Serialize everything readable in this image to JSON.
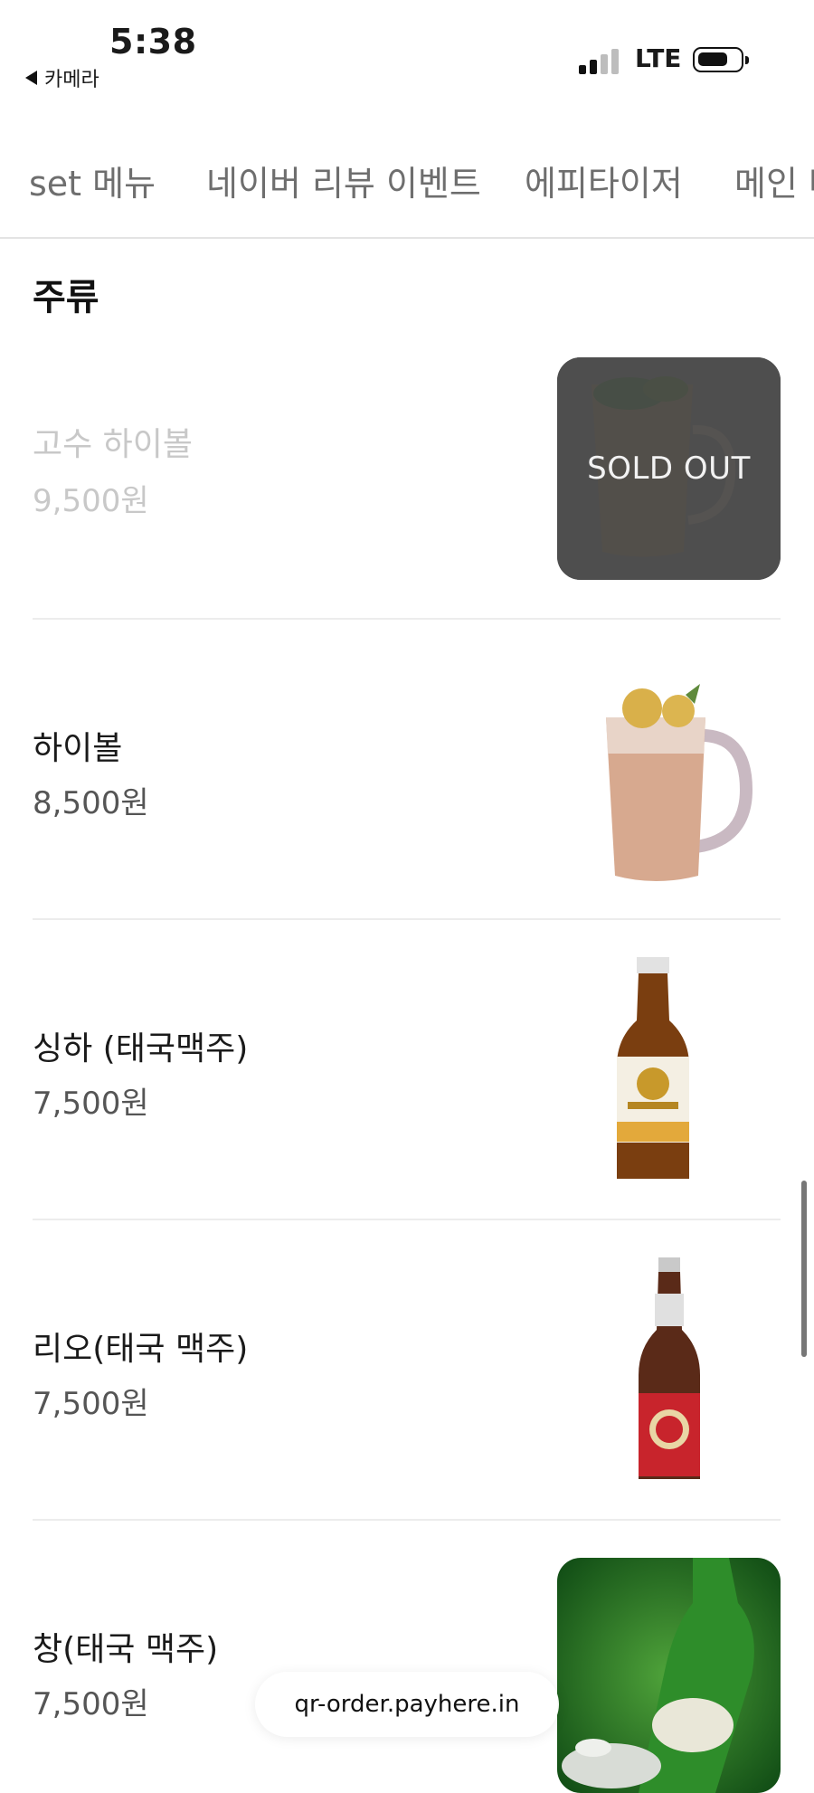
{
  "status_bar": {
    "time": "5:38",
    "back_app": "카메라",
    "network": "LTE"
  },
  "tabs": [
    "set 메뉴",
    "네이버 리뷰 이벤트",
    "에피타이저",
    "메인 다"
  ],
  "section": {
    "title": "주류"
  },
  "items": [
    {
      "name": "고수 하이볼",
      "price": "9,500원",
      "sold_out": true,
      "badge": "SOLD OUT"
    },
    {
      "name": "하이볼",
      "price": "8,500원",
      "sold_out": false
    },
    {
      "name": "싱하 (태국맥주)",
      "price": "7,500원",
      "sold_out": false
    },
    {
      "name": "리오(태국 맥주)",
      "price": "7,500원",
      "sold_out": false
    },
    {
      "name": "창(태국 맥주)",
      "price": "7,500원",
      "sold_out": false
    }
  ],
  "url": "qr-order.payhere.in",
  "colors": {
    "accent_text": "#1a1a1a",
    "muted": "#c8c8c8",
    "divider": "#ececec"
  }
}
